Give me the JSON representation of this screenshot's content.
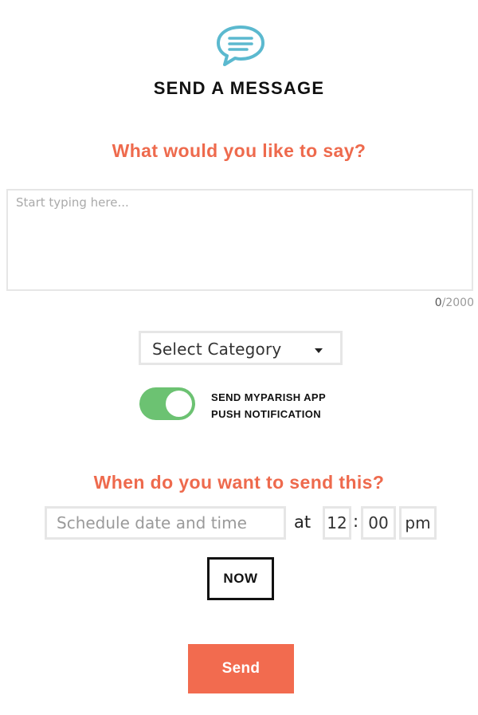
{
  "header": {
    "icon": "chat-bubble-icon",
    "title": "SEND A MESSAGE"
  },
  "message": {
    "prompt": "What would you like to say?",
    "placeholder": "Start typing here...",
    "value": "",
    "count": "0",
    "max": "/2000"
  },
  "category": {
    "selected": "Select Category",
    "icon": "caret-down-icon"
  },
  "push_notification": {
    "enabled": true,
    "label_line1": "SEND MYPARISH APP",
    "label_line2": "PUSH NOTIFICATION"
  },
  "schedule": {
    "prompt": "When do you want to send this?",
    "date_placeholder": "Schedule date and time",
    "at_label": "at",
    "hour": "12",
    "separator": ":",
    "minute": "00",
    "meridiem": "pm",
    "now_label": "NOW"
  },
  "actions": {
    "send_label": "Send"
  },
  "colors": {
    "accent": "#f26b4f",
    "prompt_text": "#ee6a4d",
    "toggle_on": "#6cc272",
    "icon_teal": "#5bb9cf"
  }
}
